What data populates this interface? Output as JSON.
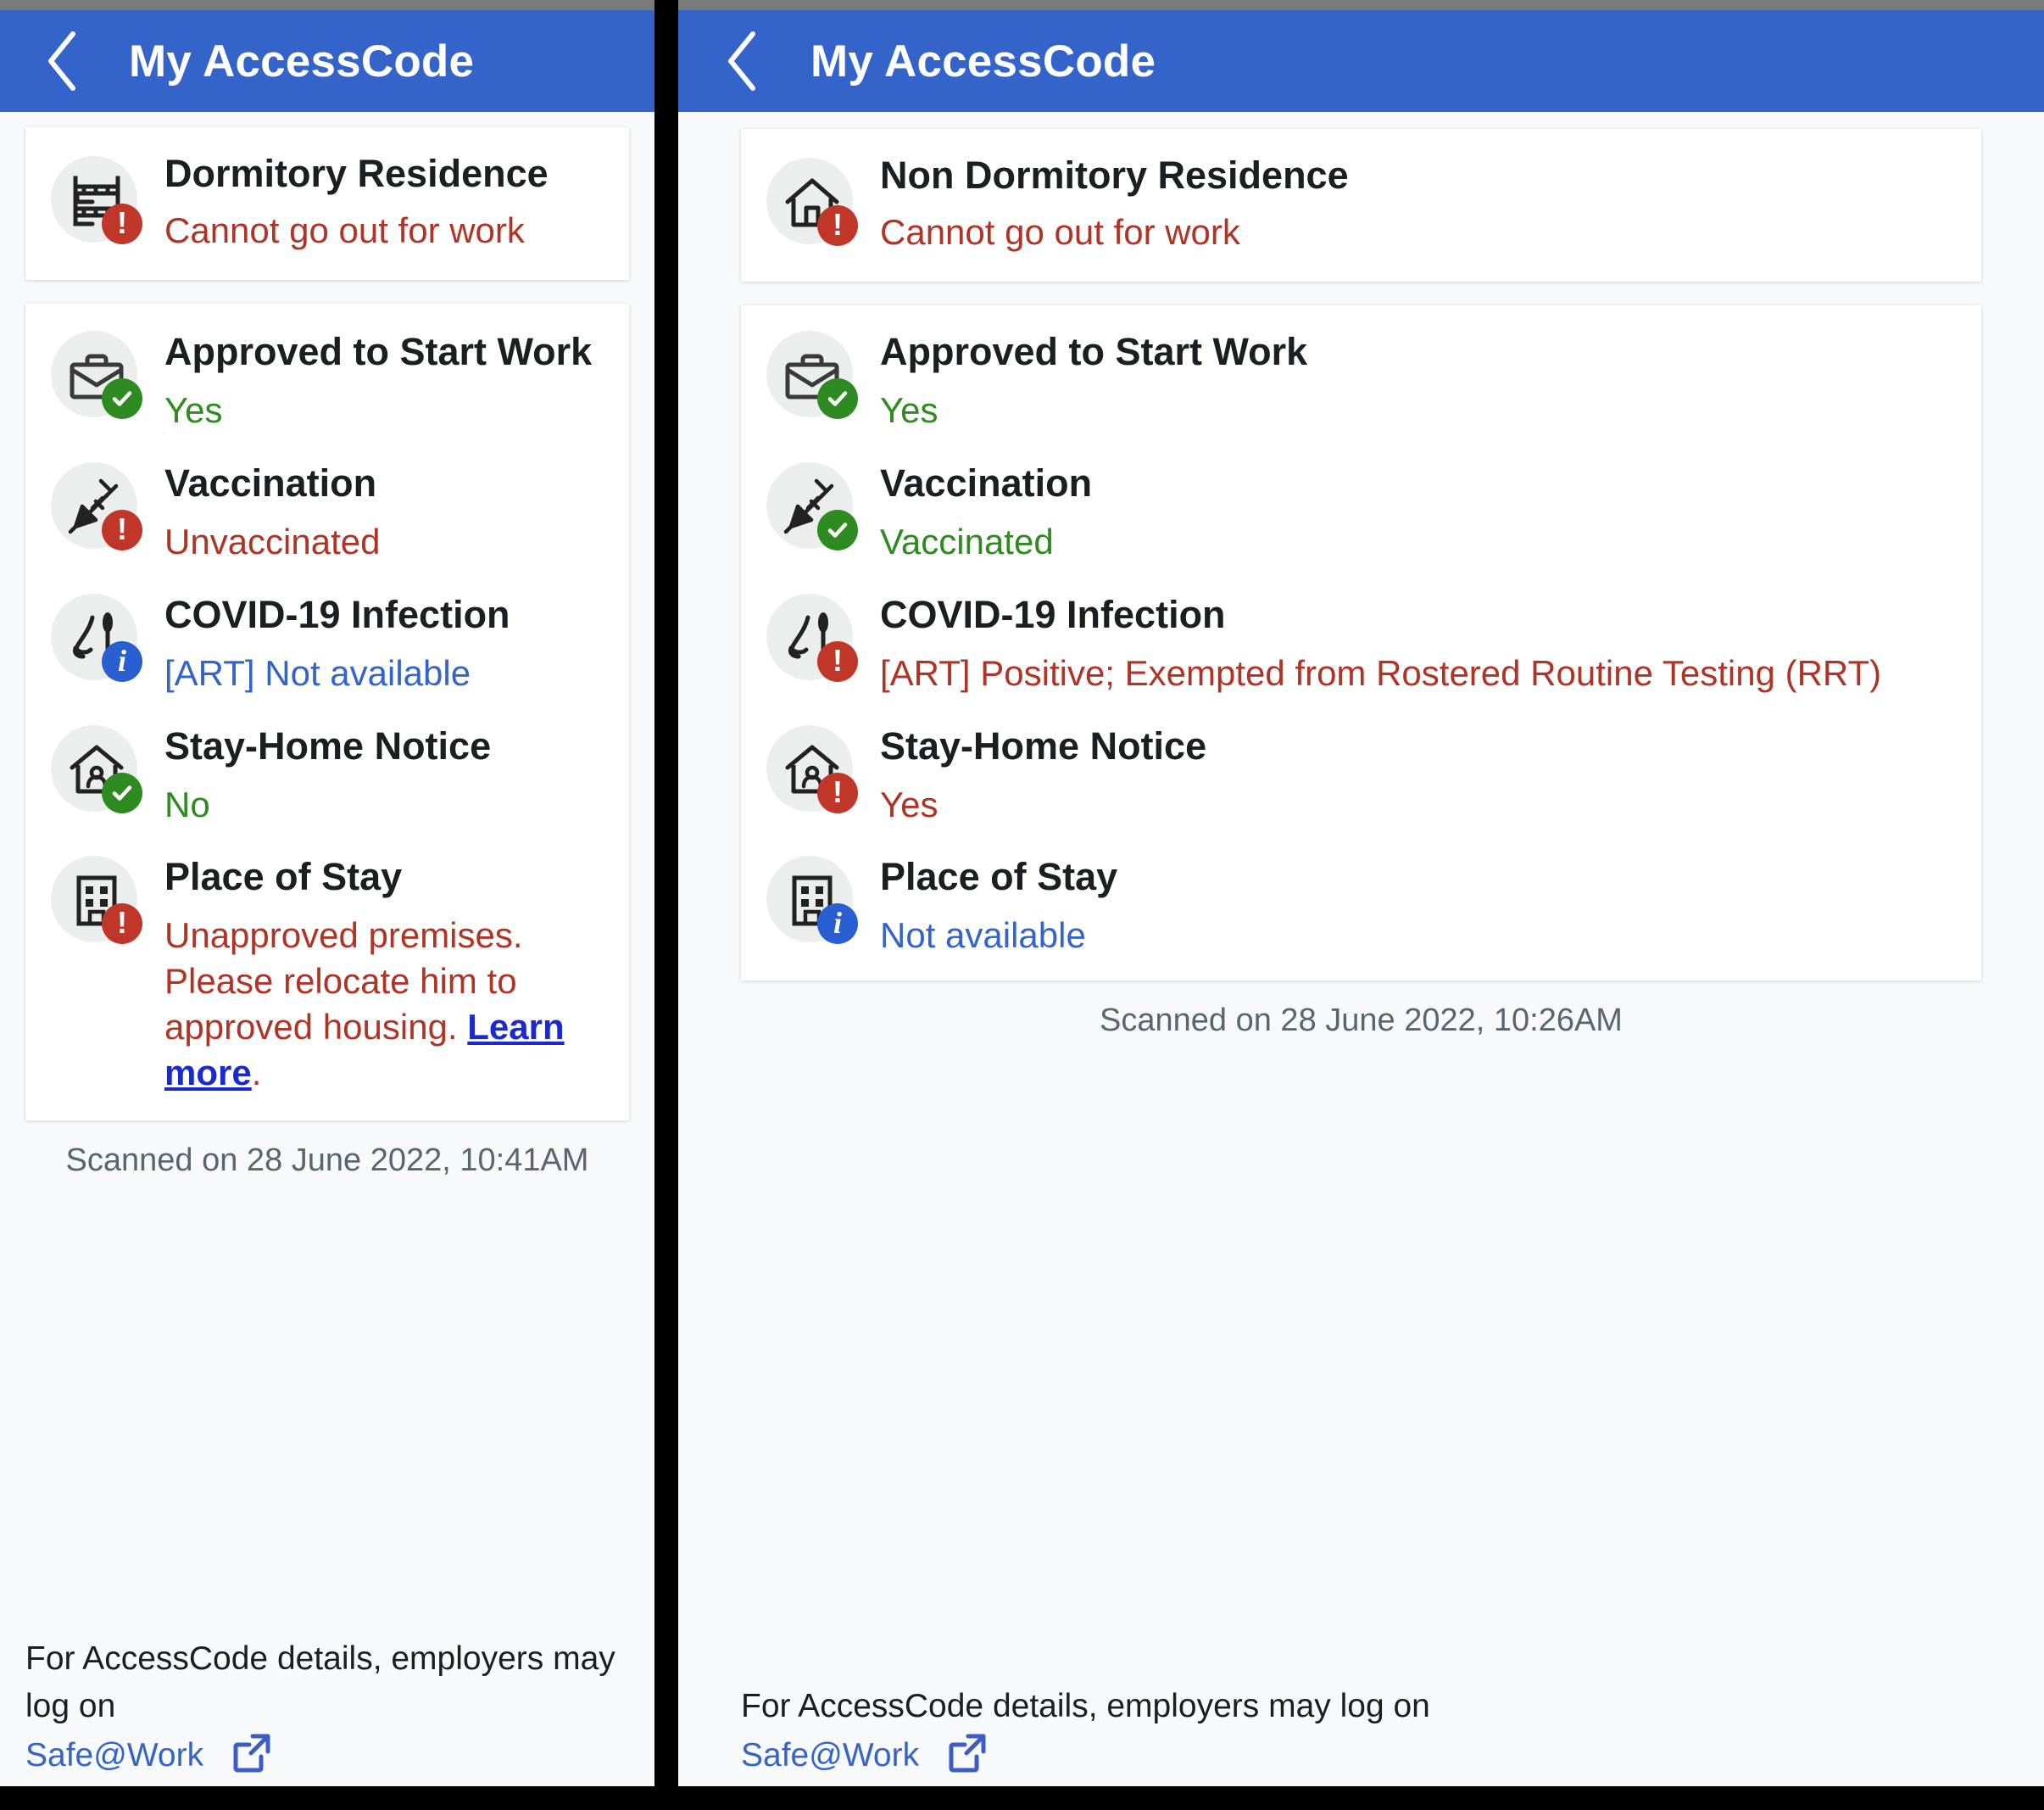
{
  "panels": [
    {
      "header": {
        "title": "My AccessCode",
        "back_icon": "chevron-left-icon"
      },
      "residence": {
        "icon": "bunk-bed-icon",
        "badge": "alert",
        "title": "Dormitory Residence",
        "value": "Cannot go out for work",
        "value_tone": "red"
      },
      "details": [
        {
          "icon": "briefcase-icon",
          "badge": "ok",
          "title": "Approved to Start Work",
          "value": "Yes",
          "value_tone": "green"
        },
        {
          "icon": "syringe-icon",
          "badge": "alert",
          "title": "Vaccination",
          "value": "Unvaccinated",
          "value_tone": "red"
        },
        {
          "icon": "nose-swab-icon",
          "badge": "info",
          "title": "COVID-19 Infection",
          "value": "[ART] Not available",
          "value_tone": "blue"
        },
        {
          "icon": "house-person-icon",
          "badge": "ok",
          "title": "Stay-Home Notice",
          "value": "No",
          "value_tone": "green"
        },
        {
          "icon": "building-icon",
          "badge": "alert",
          "title": "Place of Stay",
          "value": "Unapproved premises. Please relocate him to approved housing. ",
          "value_tone": "red",
          "link_text": "Learn more",
          "value_suffix": "."
        }
      ],
      "scanned": "Scanned on 28 June 2022, 10:41AM",
      "footer": {
        "text": "For AccessCode details, employers may log on",
        "link": "Safe@Work",
        "external_icon": "external-link-icon"
      }
    },
    {
      "header": {
        "title": "My AccessCode",
        "back_icon": "chevron-left-icon"
      },
      "residence": {
        "icon": "house-icon",
        "badge": "alert",
        "title": "Non Dormitory Residence",
        "value": "Cannot go out for work",
        "value_tone": "red"
      },
      "details": [
        {
          "icon": "briefcase-icon",
          "badge": "ok",
          "title": "Approved to Start Work",
          "value": "Yes",
          "value_tone": "green"
        },
        {
          "icon": "syringe-icon",
          "badge": "ok",
          "title": "Vaccination",
          "value": "Vaccinated",
          "value_tone": "green"
        },
        {
          "icon": "nose-swab-icon",
          "badge": "alert",
          "title": "COVID-19 Infection",
          "value": "[ART] Positive; Exempted from Rostered Routine Testing (RRT)",
          "value_tone": "red"
        },
        {
          "icon": "house-person-icon",
          "badge": "alert",
          "title": "Stay-Home Notice",
          "value": "Yes",
          "value_tone": "red"
        },
        {
          "icon": "building-icon",
          "badge": "info",
          "title": "Place of Stay",
          "value": "Not available",
          "value_tone": "blue"
        }
      ],
      "scanned": "Scanned on 28 June 2022, 10:26AM",
      "footer": {
        "text": "For AccessCode details, employers may log on",
        "link": "Safe@Work",
        "external_icon": "external-link-icon"
      }
    }
  ],
  "colors": {
    "appbar": "#3463c9",
    "alert": "#c0372a",
    "ok": "#2e8b22",
    "info": "#2a5fd2",
    "link": "#3464c8",
    "red_text": "#b03426",
    "green_text": "#2d8b1f",
    "blue_text": "#3464c8"
  }
}
